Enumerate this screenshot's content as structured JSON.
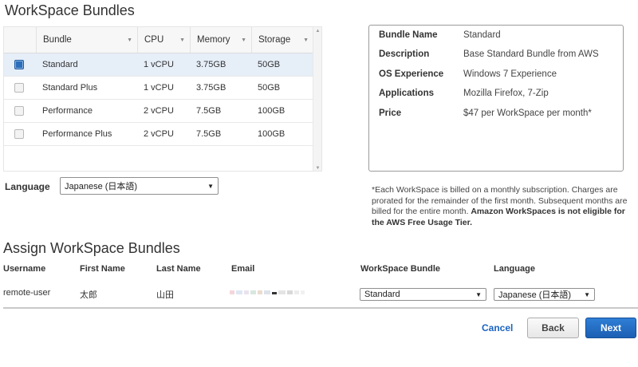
{
  "bundles_section": {
    "title": "WorkSpace Bundles",
    "columns": [
      "Bundle",
      "CPU",
      "Memory",
      "Storage"
    ],
    "rows": [
      {
        "name": "Standard",
        "cpu": "1 vCPU",
        "memory": "3.75GB",
        "storage": "50GB",
        "selected": true
      },
      {
        "name": "Standard Plus",
        "cpu": "1 vCPU",
        "memory": "3.75GB",
        "storage": "50GB",
        "selected": false
      },
      {
        "name": "Performance",
        "cpu": "2 vCPU",
        "memory": "7.5GB",
        "storage": "100GB",
        "selected": false
      },
      {
        "name": "Performance Plus",
        "cpu": "2 vCPU",
        "memory": "7.5GB",
        "storage": "100GB",
        "selected": false
      }
    ]
  },
  "details": {
    "bundle_name_label": "Bundle Name",
    "bundle_name_value": "Standard",
    "description_label": "Description",
    "description_value": "Base Standard Bundle from AWS",
    "os_label": "OS Experience",
    "os_value": "Windows 7 Experience",
    "applications_label": "Applications",
    "applications_value": "Mozilla Firefox, 7-Zip",
    "price_label": "Price",
    "price_value": "$47 per WorkSpace per month*"
  },
  "language": {
    "label": "Language",
    "selected": "Japanese (日本語)"
  },
  "billing_note": {
    "text": "*Each WorkSpace is billed on a monthly subscription. Charges are prorated for the remainder of the first month. Subsequent months are billed for the entire month.",
    "bold_text": "Amazon WorkSpaces is not eligible for the AWS Free Usage Tier."
  },
  "assign_section": {
    "title": "Assign WorkSpace Bundles",
    "headers": {
      "username": "Username",
      "first_name": "First Name",
      "last_name": "Last Name",
      "email": "Email",
      "bundle": "WorkSpace Bundle",
      "language": "Language"
    },
    "row": {
      "username": "remote-user",
      "first_name": "太郎",
      "last_name": "山田",
      "bundle": "Standard",
      "language": "Japanese (日本語)"
    }
  },
  "actions": {
    "cancel": "Cancel",
    "back": "Back",
    "next": "Next"
  },
  "colors": {
    "primary_button": "#1f66bd",
    "link": "#1a64c0",
    "selected_row": "#e6eef8"
  }
}
